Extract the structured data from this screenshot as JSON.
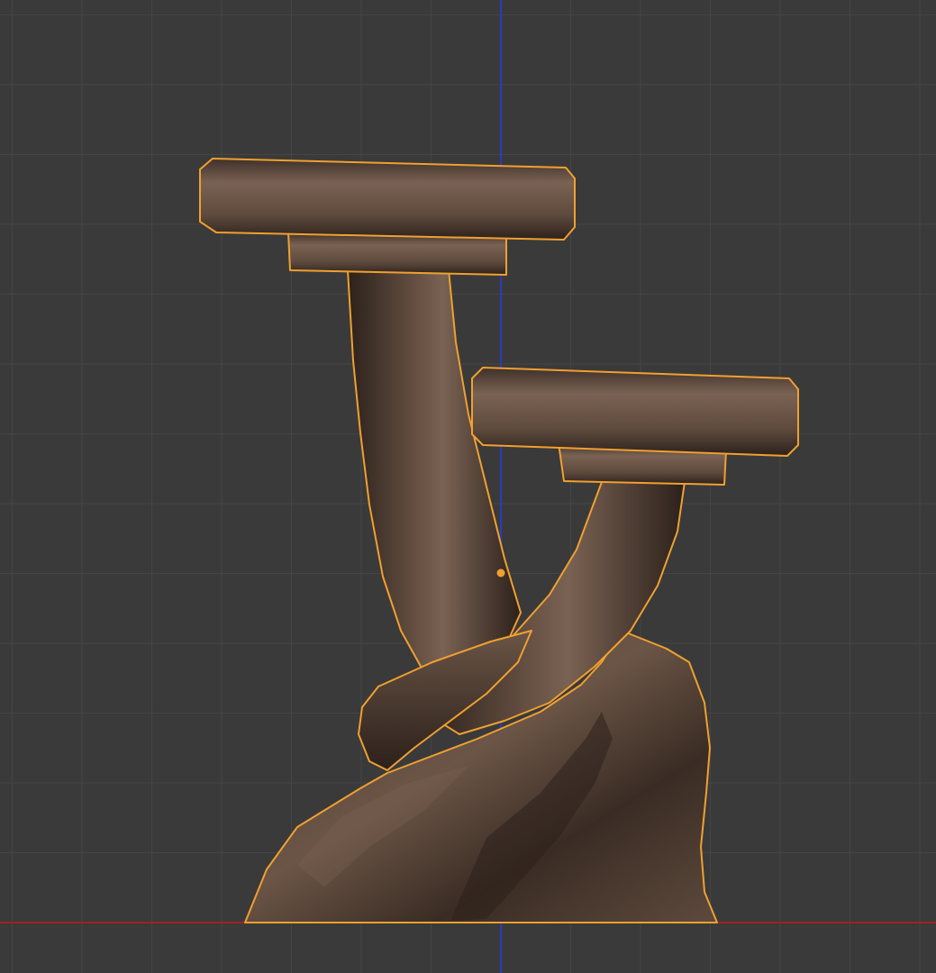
{
  "viewport": {
    "background_color": "#3a3a3a",
    "grid_color": "#454545",
    "x_axis_color": "#a32020",
    "z_axis_color": "#2a3bc0",
    "selection_outline_color": "#f0a030",
    "object_color": "#5e4a3d",
    "object_highlight_color": "#7a6253",
    "object_shadow_color": "#2c211b",
    "grid_visible": true
  },
  "object": {
    "semantic_name": "twisted-tree-plant-stand",
    "selected": true,
    "tiers": 2
  }
}
